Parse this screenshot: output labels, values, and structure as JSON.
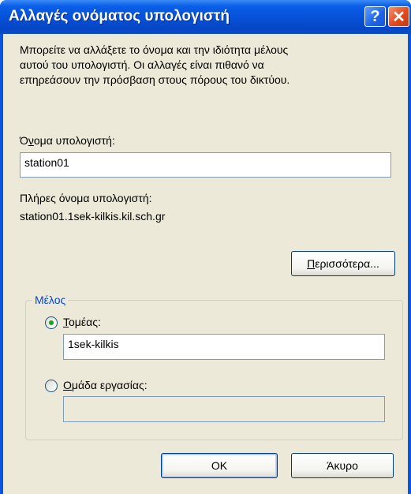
{
  "window": {
    "title": "Αλλαγές ονόματος υπολογιστή",
    "help_label": "?",
    "close_label": "✕"
  },
  "description": [
    "Μπορείτε να αλλάξετε το όνομα και την ιδιότητα μέλους",
    "αυτού του υπολογιστή. Οι αλλαγές είναι πιθανό να",
    "επηρεάσουν την πρόσβαση στους πόρους του δικτύου."
  ],
  "computer_name": {
    "label_prefix": "Ό",
    "label_underline": "ν",
    "label_rest": "ομα υπολογιστή:",
    "value": "station01"
  },
  "full_name": {
    "label": "Πλήρες όνομα υπολογιστή:",
    "value": "station01.1sek-kilkis.kil.sch.gr"
  },
  "more_button": {
    "underline": "Π",
    "rest": "ερισσότερα..."
  },
  "member_of": {
    "legend": "Μέλος",
    "domain": {
      "label_underline": "Τ",
      "label_rest": "ομέας:",
      "value": "1sek-kilkis",
      "selected": true
    },
    "workgroup": {
      "label_underline": "Ο",
      "label_rest": "μάδα εργασίας:",
      "value": "",
      "selected": false
    }
  },
  "buttons": {
    "ok": "OK",
    "cancel": "Άκυρο"
  },
  "colors": {
    "titlebar": "#0650d6",
    "dialog_bg": "#ece9d8",
    "legend_text": "#0046d5",
    "radio_dot": "#21a121"
  }
}
